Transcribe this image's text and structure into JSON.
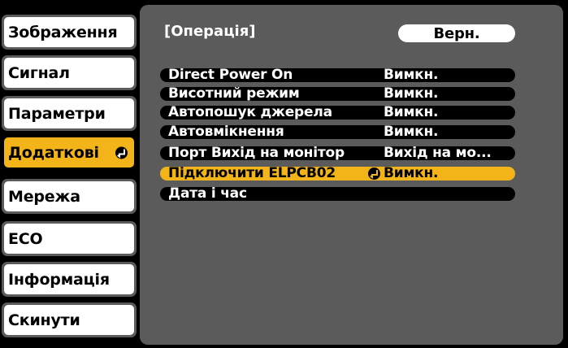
{
  "sidebar": {
    "items": [
      {
        "label": "Зображення"
      },
      {
        "label": "Сигнал"
      },
      {
        "label": "Параметри"
      },
      {
        "label": "Додаткові"
      },
      {
        "label": "Мережа"
      },
      {
        "label": "ECO"
      },
      {
        "label": "Інформація"
      },
      {
        "label": "Скинути"
      }
    ]
  },
  "panel": {
    "title": "[Операція]",
    "back_label": "Верн.",
    "rows": [
      {
        "label": "Direct Power On",
        "value": "Вимкн."
      },
      {
        "label": "Висотний режим",
        "value": "Вимкн."
      },
      {
        "label": "Автопошук джерела",
        "value": "Вимкн."
      },
      {
        "label": "Автовмікнення",
        "value": "Вимкн."
      },
      {
        "label": "Порт Вихід на монітор",
        "value": "Вихід на мо..."
      },
      {
        "label": "Підключити ELPCB02",
        "value": "Вимкн."
      },
      {
        "label": "Дата і час",
        "value": ""
      }
    ]
  },
  "colors": {
    "accent": "#f2b418",
    "panel": "#5b5b5b",
    "background": "#000000"
  }
}
